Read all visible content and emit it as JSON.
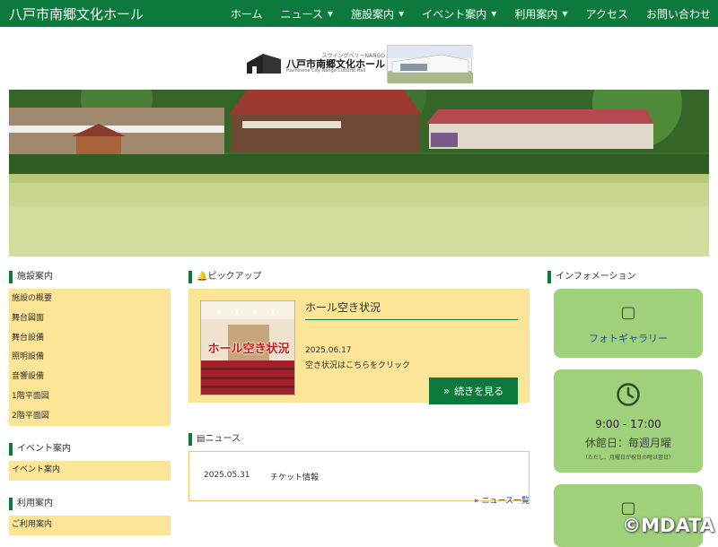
{
  "header": {
    "site_title": "八戸市南郷文化ホール",
    "nav": [
      {
        "label": "ホーム",
        "dropdown": false
      },
      {
        "label": "ニュース",
        "dropdown": true
      },
      {
        "label": "施設案内",
        "dropdown": true
      },
      {
        "label": "イベント案内",
        "dropdown": true
      },
      {
        "label": "利用案内",
        "dropdown": true
      },
      {
        "label": "アクセス",
        "dropdown": false
      },
      {
        "label": "お問い合わせ",
        "dropdown": false
      }
    ]
  },
  "logo": {
    "sub": "スウィングベリーNANGO",
    "main": "八戸市南郷文化ホール",
    "en": "Hachinohe City Nango Cultural Hall"
  },
  "sidebar_left": {
    "facilities_heading": "施設案内",
    "facilities": [
      "施設の概要",
      "舞台図面",
      "舞台設備",
      "照明設備",
      "音響設備",
      "1階平面図",
      "2階平面図"
    ],
    "events_heading": "イベント案内",
    "events": [
      "イベント案内"
    ],
    "usage_heading": "利用案内",
    "usage": [
      "ご利用案内"
    ]
  },
  "pickup": {
    "heading": "ピックアップ",
    "image_caption": "ホール空き状況",
    "title": "ホール空き状況",
    "date": "2025.06.17",
    "desc": "空き状況はこちらをクリック",
    "button": "続きを見る"
  },
  "news": {
    "heading": "ニュース",
    "items": [
      {
        "date": "2025.05.31",
        "text": "チケット情報"
      }
    ],
    "all_link": "ニュース一覧"
  },
  "info": {
    "heading": "インフォメーション",
    "gallery_label": "フォトギャラリー",
    "hours": "9:00 - 17:00",
    "closed": "休館日：毎週月曜",
    "note": "（ただし、月曜日が祝日の時は翌日）"
  },
  "watermark": "©MDATA",
  "colors": {
    "brand_green": "#0b7a3c",
    "panel_yellow": "#fce596",
    "card_green": "#9fd07a"
  }
}
